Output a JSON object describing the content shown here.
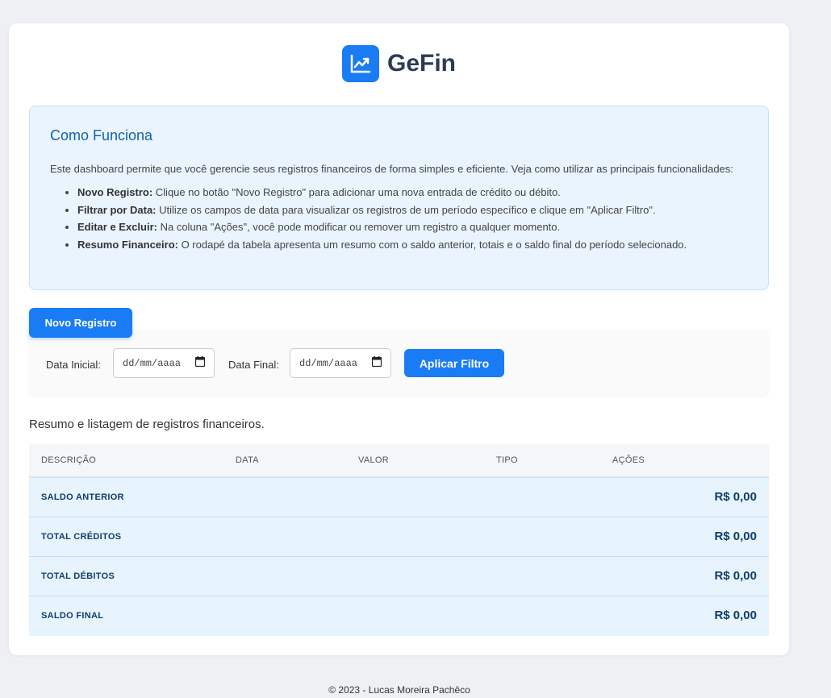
{
  "brand": {
    "name": "GeFin",
    "icon": "chart-line-icon",
    "accent": "#1a7cf5"
  },
  "info": {
    "title": "Como Funciona",
    "intro": "Este dashboard permite que você gerencie seus registros financeiros de forma simples e eficiente. Veja como utilizar as principais funcionalidades:",
    "items": [
      {
        "term": "Novo Registro:",
        "text": " Clique no botão \"Novo Registro\" para adicionar uma nova entrada de crédito ou débito."
      },
      {
        "term": "Filtrar por Data:",
        "text": " Utilize os campos de data para visualizar os registros de um período específico e clique em \"Aplicar Filtro\"."
      },
      {
        "term": "Editar e Excluir:",
        "text": " Na coluna \"Ações\", você pode modificar ou remover um registro a qualquer momento."
      },
      {
        "term": "Resumo Financeiro:",
        "text": " O rodapé da tabela apresenta um resumo com o saldo anterior, totais e o saldo final do período selecionado."
      }
    ]
  },
  "actions": {
    "new_record_label": "Novo Registro"
  },
  "filter": {
    "start_label": "Data Inicial:",
    "start_placeholder": "dd/mm/aaaa",
    "end_label": "Data Final:",
    "end_placeholder": "dd/mm/aaaa",
    "apply_label": "Aplicar Filtro",
    "calendar_icon": "calendar-icon"
  },
  "table": {
    "caption": "Resumo e listagem de registros financeiros.",
    "headers": [
      "DESCRIÇÃO",
      "DATA",
      "VALOR",
      "TIPO",
      "AÇÕES"
    ],
    "summary": [
      {
        "label": "SALDO ANTERIOR",
        "value": "R$ 0,00"
      },
      {
        "label": "TOTAL CRÉDITOS",
        "value": "R$ 0,00"
      },
      {
        "label": "TOTAL DÉBITOS",
        "value": "R$ 0,00"
      },
      {
        "label": "SALDO FINAL",
        "value": "R$ 0,00"
      }
    ]
  },
  "footer": {
    "text": "© 2023 - Lucas Moreira Pachêco"
  }
}
